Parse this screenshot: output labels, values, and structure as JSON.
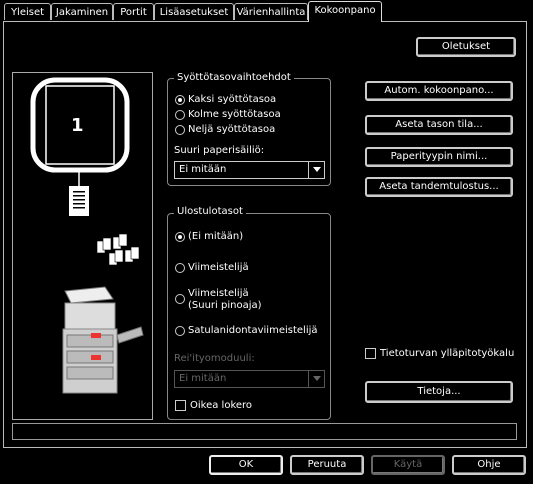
{
  "tabs": [
    {
      "label": "Yleiset"
    },
    {
      "label": "Jakaminen"
    },
    {
      "label": "Portit"
    },
    {
      "label": "Lisäasetukset"
    },
    {
      "label": "Värienhallinta"
    },
    {
      "label": "Kokoonpano"
    }
  ],
  "active_tab": "Kokoonpano",
  "preview": {
    "tray_number": "1"
  },
  "buttons": {
    "defaults": "Oletukset",
    "auto_config": "Autom. kokoonpano...",
    "tray_status": "Aseta tason tila...",
    "paper_type_name": "Paperityypin nimi...",
    "tandem": "Aseta tandemtulostus...",
    "info": "Tietoja..."
  },
  "input_trays": {
    "legend": "Syöttötasovaihtoehdot",
    "options": [
      "Kaksi syöttötasoa",
      "Kolme syöttötasoa",
      "Neljä syöttötasoa"
    ],
    "selected": "Kaksi syöttötasoa",
    "large_paper_label": "Suuri paperisäiliö:",
    "large_paper_value": "Ei mitään"
  },
  "output_trays": {
    "legend": "Ulostulotasot",
    "options": [
      "(Ei mitään)",
      "Viimeistelijä",
      "Viimeistelijä",
      "(Suuri pinoaja)",
      "Satulanidontaviimeistelijä"
    ],
    "selected": "(Ei mitään)",
    "punch_label": "Rei'ityomoduuli:",
    "punch_value": "Ei mitään",
    "right_tray": "Oikea lokero"
  },
  "security_tool": "Tietoturvan ylläpitotyökalu",
  "footer": {
    "ok": "OK",
    "cancel": "Peruuta",
    "apply": "Käytä",
    "help": "Ohje"
  }
}
